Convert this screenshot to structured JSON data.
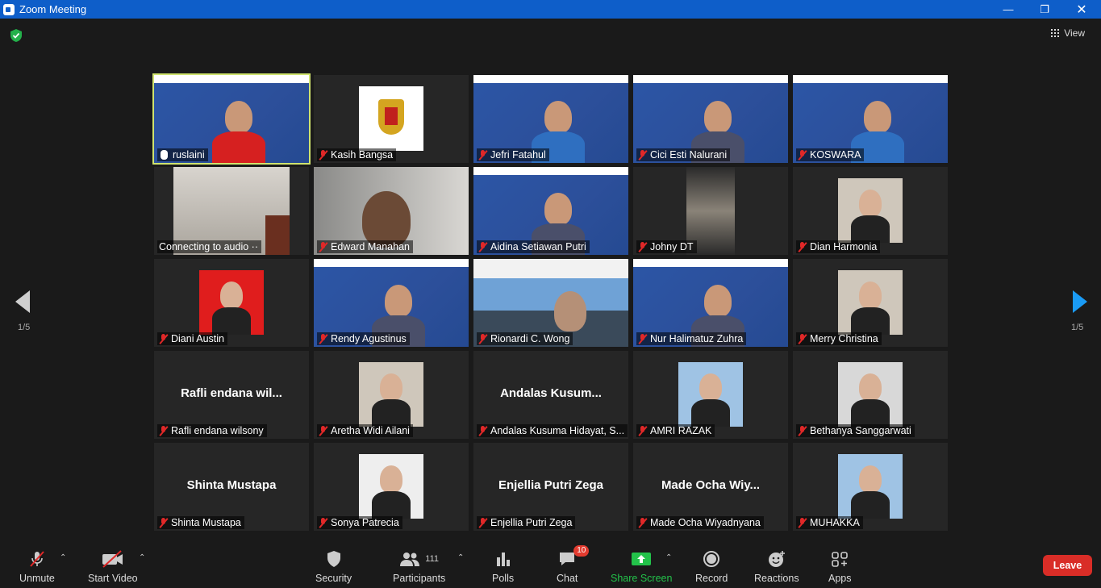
{
  "window": {
    "title": "Zoom Meeting"
  },
  "top": {
    "view_label": "View"
  },
  "pagination": {
    "left": "1/5",
    "right": "1/5"
  },
  "participants_grid": [
    {
      "name": "ruslaini",
      "kind": "seminar",
      "active": true,
      "mic": "unmuted"
    },
    {
      "name": "Kasih Bangsa",
      "kind": "logo",
      "mic": "muted"
    },
    {
      "name": "Jefri Fatahul",
      "kind": "seminar",
      "mic": "muted"
    },
    {
      "name": "Cici Esti Nalurani",
      "kind": "seminar",
      "mic": "muted"
    },
    {
      "name": "KOSWARA",
      "kind": "seminar",
      "mic": "muted"
    },
    {
      "name": "Connecting to audio ··",
      "kind": "room",
      "mic": "none"
    },
    {
      "name": "Edward Manahan",
      "kind": "person",
      "mic": "muted"
    },
    {
      "name": "Aidina Setiawan Putri",
      "kind": "seminar",
      "mic": "muted"
    },
    {
      "name": "Johny DT",
      "kind": "dark",
      "mic": "muted"
    },
    {
      "name": "Dian Harmonia",
      "kind": "photo",
      "mic": "muted"
    },
    {
      "name": "Diani Austin",
      "kind": "photo-red",
      "mic": "muted"
    },
    {
      "name": "Rendy Agustinus",
      "kind": "seminar",
      "mic": "muted"
    },
    {
      "name": "Rionardi C. Wong",
      "kind": "city",
      "mic": "muted"
    },
    {
      "name": "Nur Halimatuz Zuhra",
      "kind": "seminar",
      "mic": "muted"
    },
    {
      "name": "Merry Christina",
      "kind": "photo",
      "mic": "muted"
    },
    {
      "name": "Rafli endana wilsony",
      "big": "Rafli  endana  wil...",
      "kind": "text",
      "mic": "muted"
    },
    {
      "name": "Aretha Widi Ailani",
      "kind": "photo",
      "mic": "muted"
    },
    {
      "name": "Andalas Kusuma Hidayat, S...",
      "big": "Andalas  Kusum...",
      "kind": "text",
      "mic": "muted"
    },
    {
      "name": "AMRI RAZAK",
      "kind": "photo-sky",
      "mic": "muted"
    },
    {
      "name": "Bethanya Sanggarwati",
      "kind": "photo-room",
      "mic": "muted"
    },
    {
      "name": "Shinta Mustapa",
      "big": "Shinta Mustapa",
      "kind": "text",
      "mic": "muted"
    },
    {
      "name": "Sonya Patrecia",
      "kind": "photo-white",
      "mic": "muted"
    },
    {
      "name": "Enjellia Putri Zega",
      "big": "Enjellia Putri Zega",
      "kind": "text",
      "mic": "muted"
    },
    {
      "name": "Made Ocha Wiyadnyana",
      "big": "Made  Ocha  Wiy...",
      "kind": "text",
      "mic": "muted"
    },
    {
      "name": "MUHAKKA",
      "kind": "photo-sky",
      "mic": "muted"
    }
  ],
  "toolbar": {
    "unmute": "Unmute",
    "start_video": "Start Video",
    "security": "Security",
    "participants": "Participants",
    "participants_count": "111",
    "polls": "Polls",
    "chat": "Chat",
    "chat_badge": "10",
    "share_screen": "Share Screen",
    "record": "Record",
    "reactions": "Reactions",
    "apps": "Apps",
    "leave": "Leave"
  },
  "colors": {
    "titlebar": "#0e5ec9",
    "active_speaker": "#cfe36e",
    "share": "#23c24a",
    "leave": "#d92d27",
    "muted": "#e02828"
  }
}
